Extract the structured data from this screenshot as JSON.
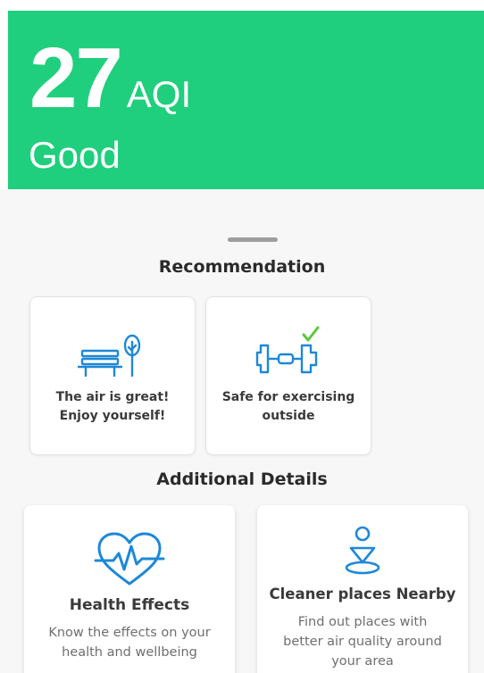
{
  "header": {
    "aqi_value": "27",
    "aqi_unit": "AQI",
    "status": "Good",
    "color": "#1fcf7d"
  },
  "recommendation": {
    "title": "Recommendation",
    "cards": [
      {
        "icon": "park-bench-icon",
        "text_line1": "The air is great!",
        "text_line2": "Enjoy yourself!"
      },
      {
        "icon": "dumbbell-check-icon",
        "text_line1": "Safe for exercising",
        "text_line2": "outside"
      }
    ]
  },
  "additional": {
    "title": "Additional Details",
    "cards": [
      {
        "icon": "heart-pulse-icon",
        "title": "Health Effects",
        "desc_line1": "Know the effects on your",
        "desc_line2": "health and wellbeing"
      },
      {
        "icon": "location-pin-icon",
        "title": "Cleaner places Nearby",
        "desc_line1": "Find out places with",
        "desc_line2": "better air quality around",
        "desc_line3": "your area"
      }
    ]
  },
  "colors": {
    "accent": "#1fcf7d",
    "icon_blue": "#1e88d6",
    "check_green": "#5cc93b"
  }
}
